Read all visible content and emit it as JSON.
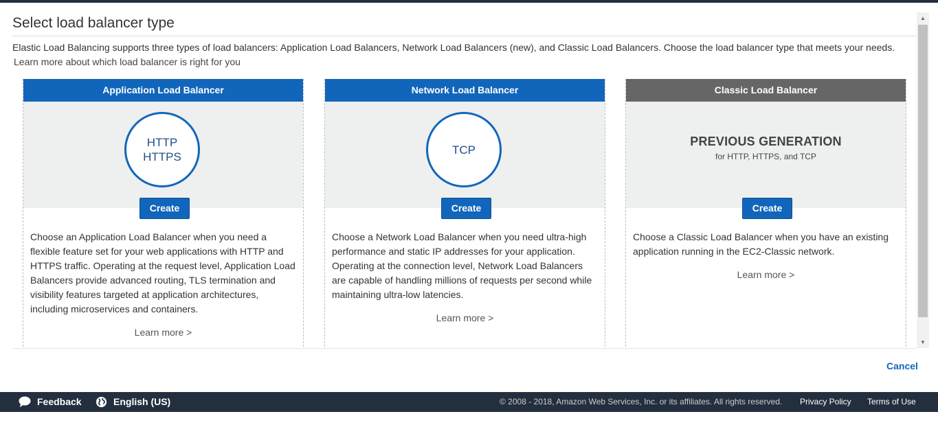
{
  "page": {
    "title": "Select load balancer type",
    "description": "Elastic Load Balancing supports three types of load balancers: Application Load Balancers, Network Load Balancers (new), and Classic Load Balancers. Choose the load balancer type that meets your needs.",
    "learn_more_link": "Learn more about which load balancer is right for you"
  },
  "cards": [
    {
      "header": "Application Load Balancer",
      "header_color": "#1166bb",
      "protocols": [
        "HTTP",
        "HTTPS"
      ],
      "create_label": "Create",
      "body": "Choose an Application Load Balancer when you need a flexible feature set for your web applications with HTTP and HTTPS traffic. Operating at the request level, Application Load Balancers provide advanced routing, TLS termination and visibility features targeted at application architectures, including microservices and containers.",
      "learn_more": "Learn more >"
    },
    {
      "header": "Network Load Balancer",
      "header_color": "#1166bb",
      "protocols": [
        "TCP"
      ],
      "create_label": "Create",
      "body": "Choose a Network Load Balancer when you need ultra-high performance and static IP addresses for your application. Operating at the connection level, Network Load Balancers are capable of handling millions of requests per second while maintaining ultra-low latencies.",
      "learn_more": "Learn more >"
    },
    {
      "header": "Classic Load Balancer",
      "header_color": "#666666",
      "generation": "PREVIOUS GENERATION",
      "generation_sub": "for HTTP, HTTPS, and TCP",
      "create_label": "Create",
      "body": "Choose a Classic Load Balancer when you have an existing application running in the EC2-Classic network.",
      "learn_more": "Learn more >"
    }
  ],
  "actions": {
    "cancel": "Cancel"
  },
  "footer": {
    "feedback": "Feedback",
    "language": "English (US)",
    "copyright": "© 2008 - 2018, Amazon Web Services, Inc. or its affiliates. All rights reserved.",
    "privacy": "Privacy Policy",
    "terms": "Terms of Use"
  },
  "colors": {
    "accent": "#1166bb",
    "footer_bg": "#232f3e",
    "hero_bg": "#eeefef"
  },
  "icons": [
    "chat-bubble-icon",
    "globe-icon",
    "scroll-up-icon",
    "scroll-down-icon"
  ]
}
